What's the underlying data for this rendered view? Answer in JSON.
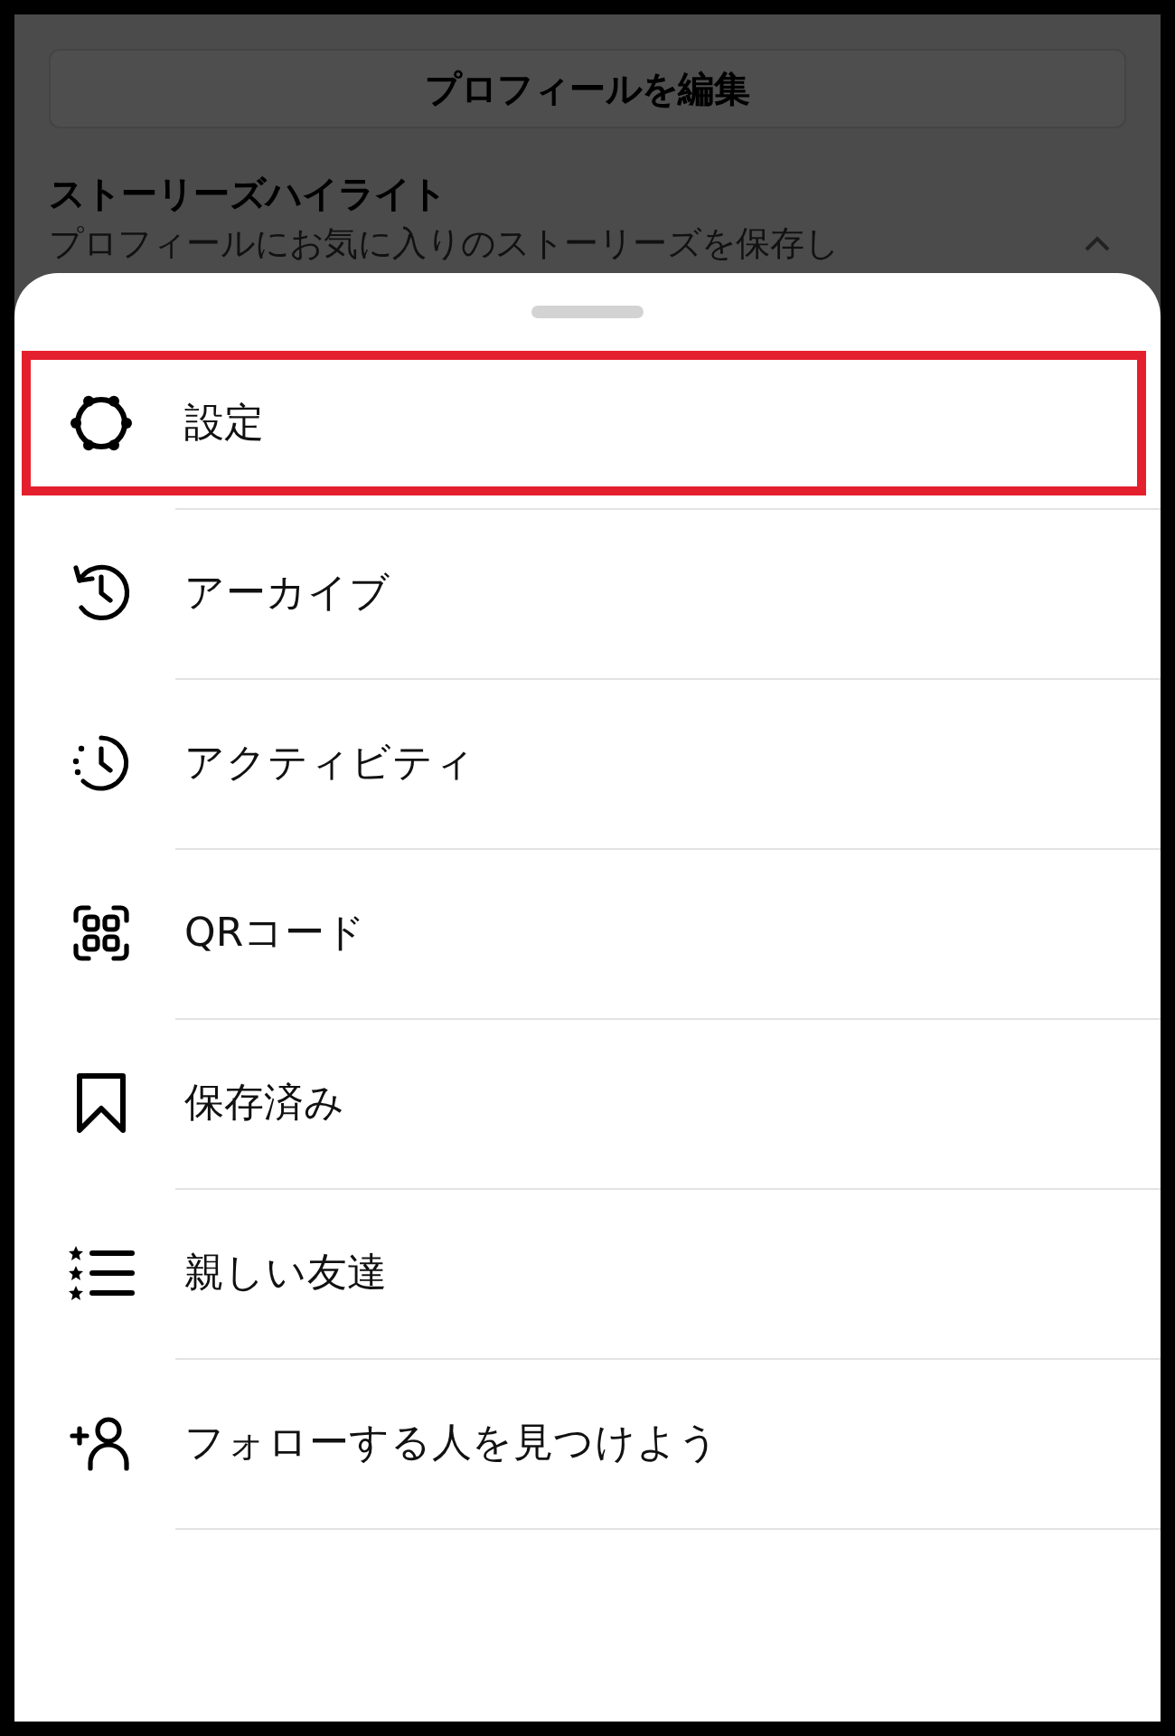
{
  "profile": {
    "edit_button": "プロフィールを編集",
    "highlights_title": "ストーリーズハイライト",
    "highlights_description": "プロフィールにお気に入りのストーリーズを保存し",
    "expanded": true
  },
  "menu": [
    {
      "kind": "settings",
      "label": "設定",
      "highlighted": true
    },
    {
      "kind": "archive",
      "label": "アーカイブ",
      "highlighted": false
    },
    {
      "kind": "activity",
      "label": "アクティビティ",
      "highlighted": false
    },
    {
      "kind": "qr",
      "label": "QRコード",
      "highlighted": false
    },
    {
      "kind": "saved",
      "label": "保存済み",
      "highlighted": false
    },
    {
      "kind": "close_friends",
      "label": "親しい友達",
      "highlighted": false
    },
    {
      "kind": "discover",
      "label": "フォローする人を見つけよう",
      "highlighted": false
    }
  ]
}
